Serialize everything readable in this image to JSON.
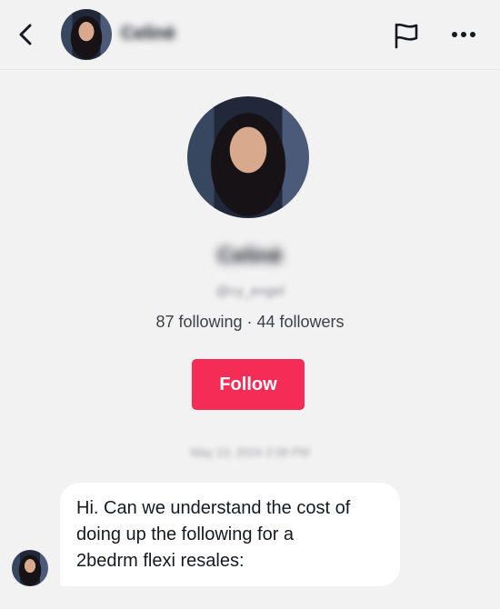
{
  "header": {
    "back_icon": "chevron-left-icon",
    "avatar": "user-avatar",
    "name": "Celinè",
    "flag_icon": "flag-icon",
    "more_icon": "more-horizontal-icon"
  },
  "profile": {
    "name": "Celinè",
    "handle": "@cy_engel",
    "stats": "87 following · 44 followers",
    "follow_label": "Follow"
  },
  "conversation": {
    "timestamp": "May 13, 2024 2:58 PM",
    "message_lines": [
      "Hi. Can we understand the cost of",
      "doing up the following for a",
      "2bedrm flexi resales:"
    ]
  },
  "colors": {
    "accent": "#f52c56",
    "background": "#f2f2f2",
    "bubble": "#ffffff"
  }
}
